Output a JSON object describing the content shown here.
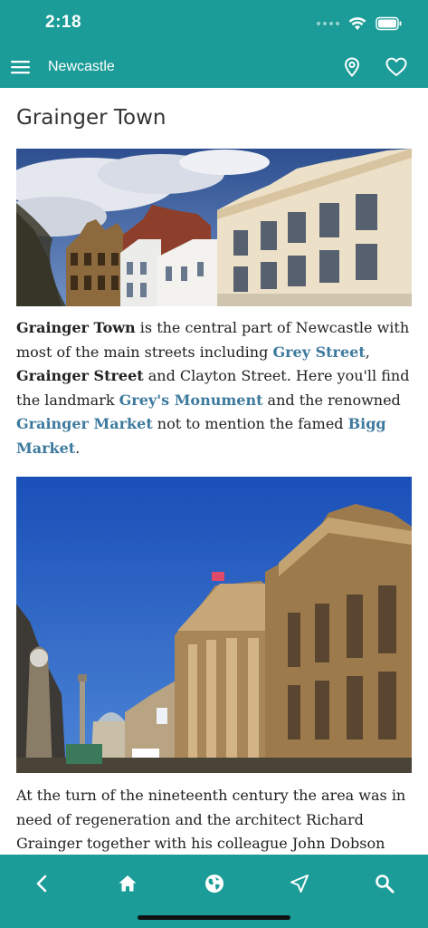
{
  "status_bar": {
    "time": "2:18"
  },
  "nav": {
    "title": "Newcastle",
    "icons": [
      "menu-icon",
      "map-pin-icon",
      "heart-icon"
    ]
  },
  "page": {
    "title": "Grainger Town"
  },
  "paragraph_1": {
    "t1": "Grainger Town",
    "t2": " is the central part of Newcastle with most of the main streets including ",
    "t3": "Grey Street",
    "t4": ", ",
    "t5": "Grainger Street",
    "t6": " and Clayton Street. Here you'll find the landmark ",
    "t7": "Grey's Monument",
    "t8": " and the renowned ",
    "t9": "Grainger Market",
    "t10": " not to mention the famed ",
    "t11": "Bigg Market",
    "t12": "."
  },
  "paragraph_2": {
    "text": "At the turn of the nineteenth century the area was in need of regeneration and the architect Richard Grainger together with his colleague John Dobson were"
  },
  "bottom_tabs": [
    "back-icon",
    "home-icon",
    "globe-icon",
    "navigate-icon",
    "search-icon"
  ],
  "colors": {
    "accent": "#1b9c98",
    "link": "#3d7a9e",
    "text": "#222222"
  }
}
